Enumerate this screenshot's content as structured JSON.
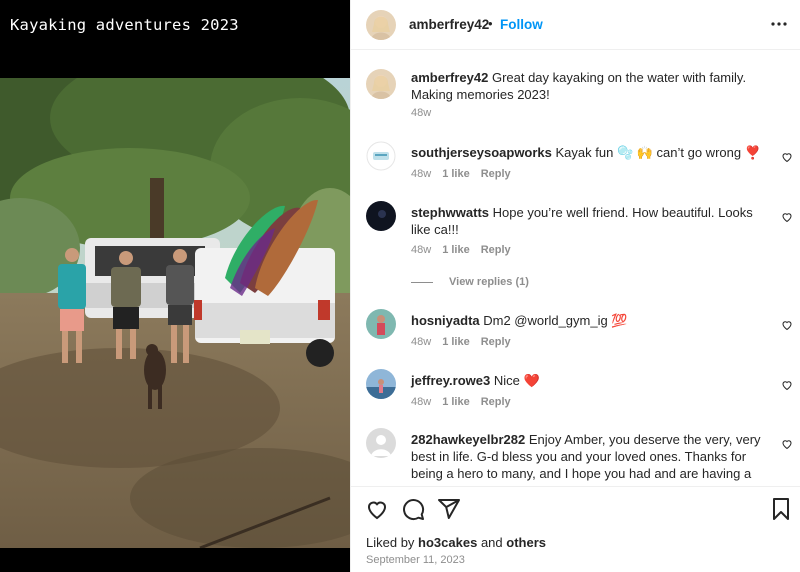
{
  "media": {
    "caption": "Kayaking adventures 2023"
  },
  "header": {
    "username": "amberfrey42",
    "separator": "•",
    "follow_label": "Follow",
    "more_icon": "more-horizontal-icon"
  },
  "comments": [
    {
      "username": "amberfrey42",
      "text": "Great day kayaking on the water with family. Making memories 2023!",
      "time": "48w"
    },
    {
      "username": "southjerseysoapworks",
      "text": "Kayak fun 🫧 🙌 can’t go wrong ❣️",
      "time": "48w",
      "likes": "1 like",
      "reply": "Reply"
    },
    {
      "username": "stephwwatts",
      "text": "Hope you’re well friend. How beautiful. Looks like ca!!!",
      "time": "48w",
      "likes": "1 like",
      "reply": "Reply",
      "view_replies": "View replies (1)"
    },
    {
      "username": "hosniyadta",
      "text": "Dm2 @world_gym_ig 💯",
      "time": "48w",
      "likes": "1 like",
      "reply": "Reply"
    },
    {
      "username": "jeffrey.rowe3",
      "text": "Nice ❤️",
      "time": "48w",
      "likes": "1 like",
      "reply": "Reply"
    },
    {
      "username": "282hawkeyelbr282",
      "text": "Enjoy Amber, you deserve the very, very best in life. G-d bless you and your loved ones. Thanks for being a hero to many, and I hope you had and are having a wonderful time. We love you."
    }
  ],
  "footer": {
    "liked_prefix": "Liked by",
    "liked_user": "ho3cakes",
    "liked_and": "and",
    "liked_others": "others",
    "date": "September 11, 2023"
  },
  "colors": {
    "accent": "#0095f6",
    "muted": "#8e8e8e",
    "text": "#262626",
    "heart_red": "#ed4956"
  }
}
